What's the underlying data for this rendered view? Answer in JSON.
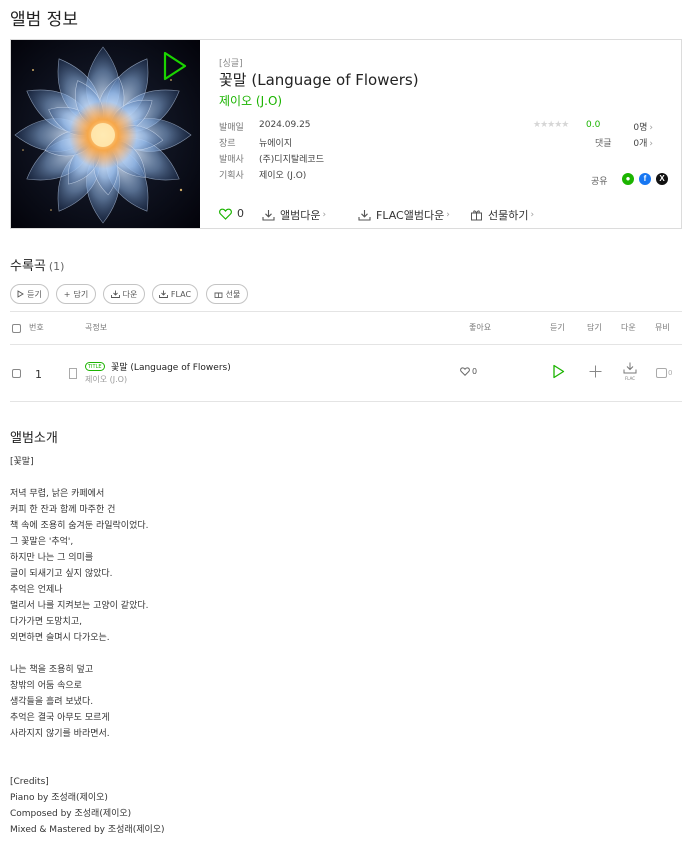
{
  "page": {
    "title": "앨범 정보"
  },
  "album": {
    "type": "[싱글]",
    "name": "꽃말 (Language of Flowers)",
    "artist": "제이오 (J.O)",
    "meta": [
      {
        "key": "발매일",
        "value": "2024.09.25"
      },
      {
        "key": "장르",
        "value": "뉴에이지"
      },
      {
        "key": "발매사",
        "value": "(주)디지탈레코드"
      },
      {
        "key": "기획사",
        "value": "제이오 (J.O)"
      }
    ],
    "rating": "0.0",
    "rating_stars": 0,
    "rating_count": "0명",
    "comments_label": "댓글",
    "comments_count": "0개",
    "share_label": "공유",
    "share_icons": [
      {
        "name": "kakao-share-icon",
        "glyph": "●",
        "color": "#1bb400"
      },
      {
        "name": "facebook-share-icon",
        "glyph": "f",
        "color": "#1877f2"
      },
      {
        "name": "x-share-icon",
        "glyph": "𝕏",
        "color": "#111111"
      }
    ],
    "likes": "0",
    "actions": {
      "album_download": "앨범다운",
      "flac_download": "FLAC앨범다운",
      "gift": "선물하기"
    }
  },
  "tracklist": {
    "title": "수록곡",
    "count": "(1)",
    "buttons": {
      "listen": "듣기",
      "add": "담기",
      "download": "다운",
      "flac": "FLAC",
      "gift": "선물"
    },
    "headers": {
      "number": "번호",
      "song_info": "곡정보",
      "likes": "좋아요",
      "listen": "듣기",
      "add": "담기",
      "download": "다운",
      "mv": "뮤비"
    },
    "rows": [
      {
        "number": "1",
        "badge": "TITLE",
        "title": "꽃말 (Language of Flowers)",
        "artist": "제이오 (J.O)",
        "likes": "0",
        "download_label": "FLAC",
        "mv_count": "0"
      }
    ]
  },
  "intro": {
    "title": "앨범소개",
    "lines": [
      "[꽃말]",
      "",
      "저녁 무렵, 낡은 카페에서",
      "커피 한 잔과 함께 마주한 건",
      "책 속에 조용히 숨겨둔 라일락이었다.",
      "그 꽃말은 '추억',",
      "하지만 나는 그 의미를",
      "글이 되새기고 싶지 않았다.",
      "추억은 언제나",
      "멀리서 나를 지켜보는 고양이 같았다.",
      "다가가면 도망치고,",
      "외면하면 슬며시 다가오는.",
      "",
      "나는 책을 조용히 덮고",
      "창밖의 어둠 속으로",
      "생각들을 흘려 보냈다.",
      "추억은 결국 아무도 모르게",
      "사라지지 않기를 바라면서.",
      "",
      "",
      "[Credits]",
      "Piano by 조성래(제이오)",
      "Composed by 조성래(제이오)",
      "Mixed & Mastered by 조성래(제이오)"
    ]
  },
  "colors": {
    "accent": "#1bb400",
    "border": "#dcdcdc"
  }
}
